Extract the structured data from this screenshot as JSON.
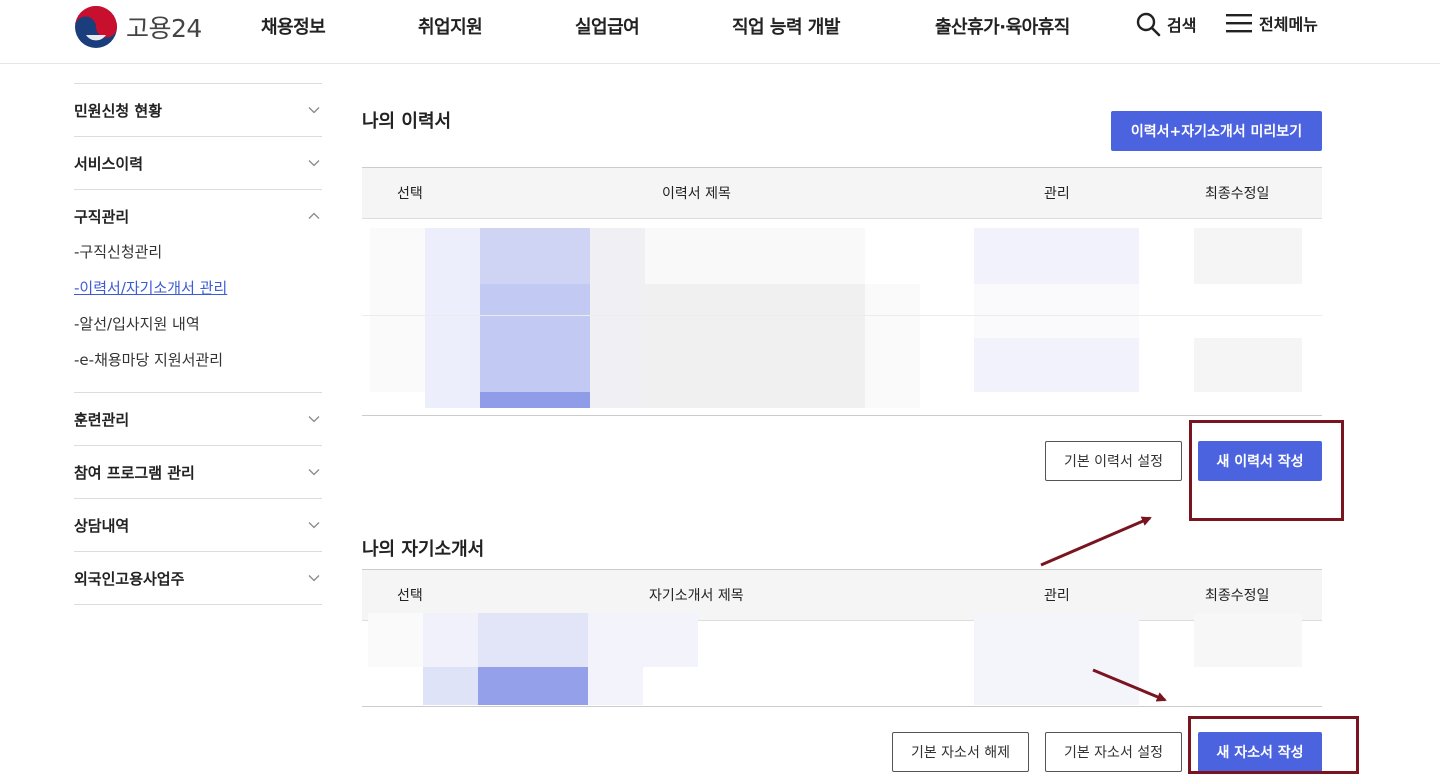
{
  "header": {
    "logo_text": "고용24",
    "nav": [
      "채용정보",
      "취업지원",
      "실업급여",
      "직업 능력 개발",
      "출산휴가·육아휴직"
    ],
    "search_label": "검색",
    "menu_label": "전체메뉴"
  },
  "sidebar": {
    "groups": [
      {
        "label": "민원신청 현황"
      },
      {
        "label": "서비스이력"
      },
      {
        "label": "구직관리",
        "sub": [
          "구직신청관리",
          "이력서/자기소개서 관리",
          "알선/입사지원 내역",
          "e-채용마당 지원서관리"
        ]
      },
      {
        "label": "훈련관리"
      },
      {
        "label": "참여 프로그램 관리"
      },
      {
        "label": "상담내역"
      },
      {
        "label": "외국인고용사업주"
      }
    ]
  },
  "resume": {
    "title": "나의 이력서",
    "preview_button": "이력서+자기소개서 미리보기",
    "columns": [
      "선택",
      "이력서 제목",
      "관리",
      "최종수정일"
    ],
    "default_button": "기본 이력서 설정",
    "new_button": "새 이력서 작성"
  },
  "cover": {
    "title": "나의 자기소개서",
    "columns": [
      "선택",
      "자기소개서 제목",
      "관리",
      "최종수정일"
    ],
    "unset_button": "기본 자소서 해제",
    "default_button": "기본 자소서 설정",
    "new_button": "새 자소서 작성"
  },
  "colors": {
    "primary": "#4c63e0",
    "annotation": "#7a1420"
  }
}
